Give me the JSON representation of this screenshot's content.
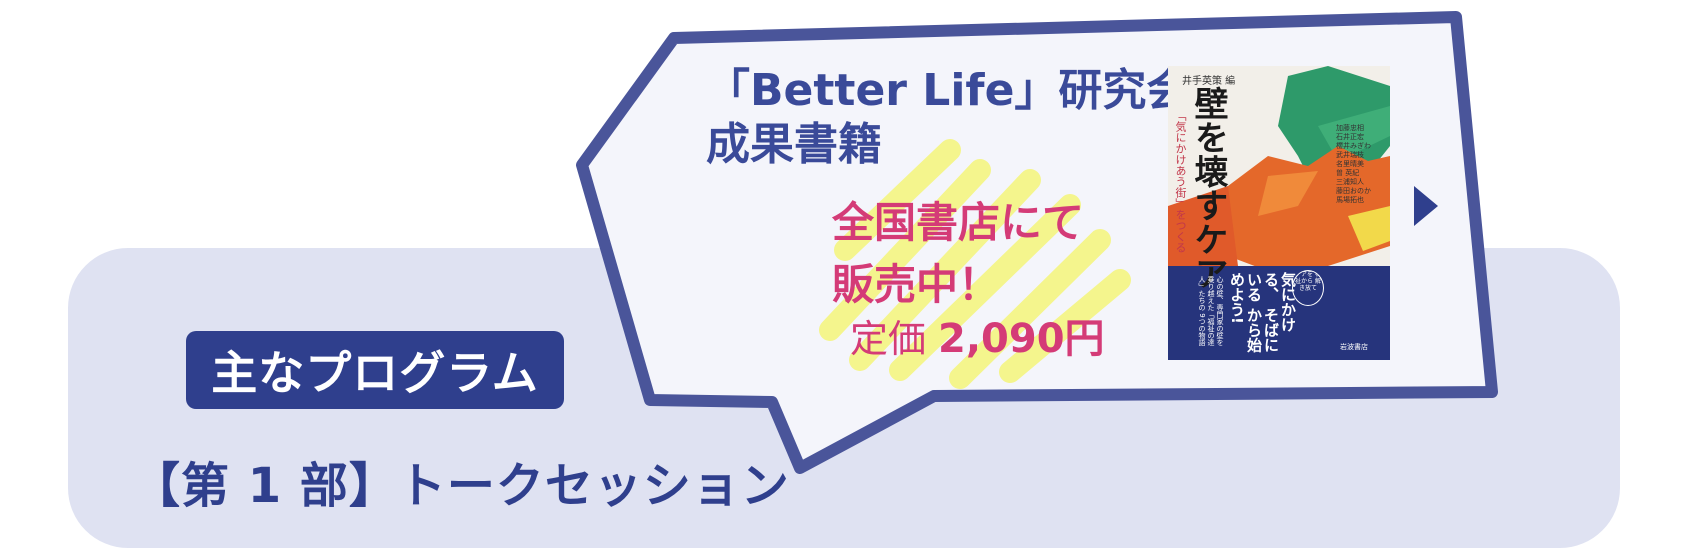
{
  "program": {
    "badge_label": "主なプログラム",
    "section_heading": "【第 1 部】トークセッション"
  },
  "promo": {
    "title_line1": "「Better Life」研究会",
    "title_line2": "成果書籍",
    "sale_line1": "全国書店にて",
    "sale_line2": "販売中！",
    "price_label": "定価",
    "price_value": "2,090円"
  },
  "book": {
    "editor": "井手英策 編",
    "title": "壁を壊すケア",
    "subtitle": "「気にかけあう街」をつくる",
    "authors": [
      "加藤忠相",
      "石井正宏",
      "櫻井みぎわ",
      "武井瑞枝",
      "名里晴美",
      "曽 英紀",
      "三浦知人",
      "藤田おのか",
      "馬場拓也"
    ],
    "band_text_1": "気にかける、",
    "band_text_2": "そばにいる",
    "band_text_3": "から始めよう!",
    "band_tag": "ケアを 福祉から 解き放て",
    "band_small": "心の壁、専門家の壁を 乗り越えた「福祉の達人」たちの 9つの物語",
    "publisher": "岩波書店"
  },
  "colors": {
    "navy": "#2f3f8d",
    "bubble_border": "#4a559a",
    "panel_bg": "#dfe2f2",
    "accent_pink": "#d43b77",
    "highlight_yellow": "#f4f57a"
  }
}
